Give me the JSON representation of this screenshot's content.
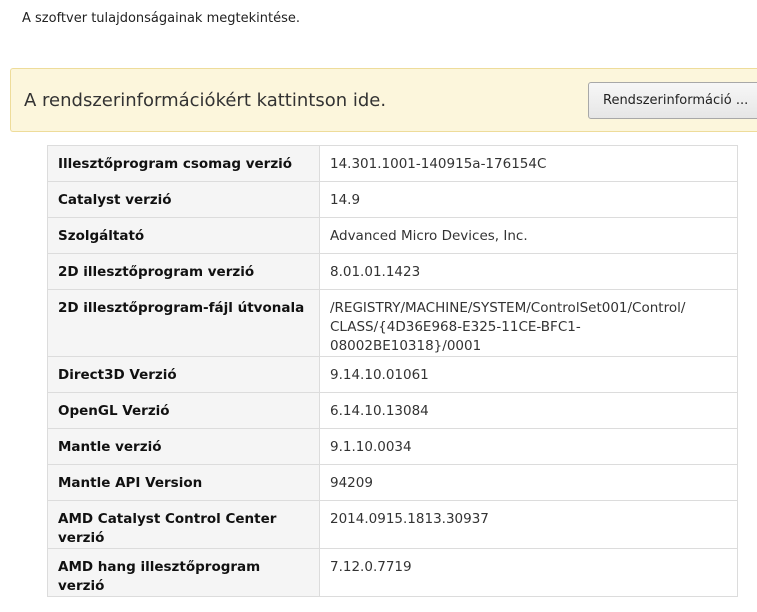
{
  "header": {
    "subtitle": "A szoftver tulajdonságainak megtekintése."
  },
  "banner": {
    "text": "A rendszerinformációkért kattintson ide.",
    "button_label": "Rendszerinformáció ..."
  },
  "properties": [
    {
      "label": "Illesztőprogram csomag verzió",
      "value": "14.301.1001-140915a-176154C"
    },
    {
      "label": "Catalyst verzió",
      "value": "14.9"
    },
    {
      "label": "Szolgáltató",
      "value": "Advanced Micro Devices, Inc."
    },
    {
      "label": "2D illesztőprogram verzió",
      "value": "8.01.01.1423"
    },
    {
      "label": "2D illesztőprogram-fájl útvonala",
      "value_line1": "/REGISTRY/MACHINE/SYSTEM/ControlSet001/Control/",
      "value_line2": "CLASS/{4D36E968-E325-11CE-BFC1-08002BE10318}/0001"
    },
    {
      "label": "Direct3D Verzió",
      "value": "9.14.10.01061"
    },
    {
      "label": "OpenGL Verzió",
      "value": "6.14.10.13084"
    },
    {
      "label": "Mantle verzió",
      "value": "9.1.10.0034"
    },
    {
      "label": "Mantle API Version",
      "value": "94209"
    },
    {
      "label": "AMD Catalyst Control Center verzió",
      "value": "2014.0915.1813.30937"
    },
    {
      "label": "AMD hang illesztőprogram verzió",
      "value": "7.12.0.7719"
    }
  ]
}
